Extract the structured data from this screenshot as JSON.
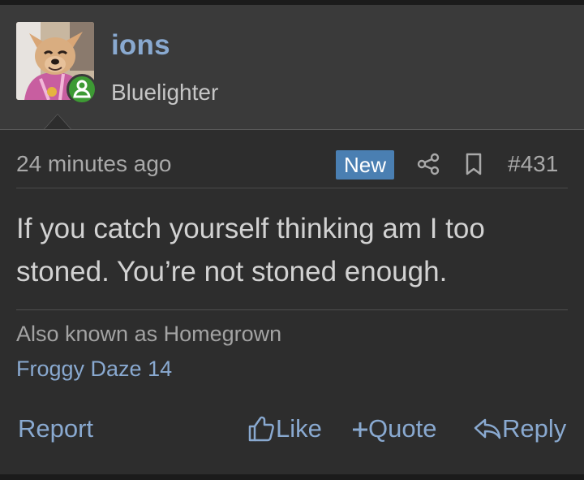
{
  "post": {
    "author": {
      "username": "ions",
      "title": "Bluelighter",
      "avatar_icon": "dog-avatar",
      "status_icon": "online-user-icon"
    },
    "meta": {
      "timestamp": "24 minutes ago",
      "badge": "New",
      "share_icon": "share-icon",
      "bookmark_icon": "bookmark-icon",
      "number": "#431"
    },
    "message": "If you catch yourself thinking am I too stoned. You’re not stoned enough.",
    "signature": {
      "line1": "Also known as Homegrown",
      "line2": "Froggy Daze 14"
    },
    "actions": {
      "report": "Report",
      "like": "Like",
      "quote": "Quote",
      "reply": "Reply"
    }
  },
  "colors": {
    "background": "#2d2d2d",
    "header": "#3a3a3a",
    "link": "#89a9d0",
    "badge": "#4a7fb2",
    "online": "#3d9a34"
  }
}
